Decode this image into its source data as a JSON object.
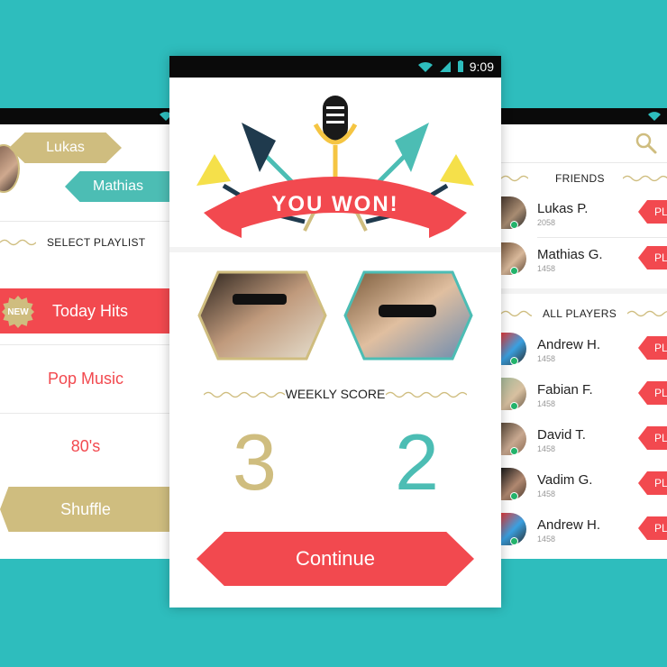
{
  "left_screen": {
    "players": [
      {
        "name": "Lukas"
      },
      {
        "name": "Mathias"
      }
    ],
    "section_title": "SELECT PLAYLIST",
    "playlists": [
      {
        "label": "Today Hits",
        "badge": "NEW"
      },
      {
        "label": "Pop Music"
      },
      {
        "label": "80's"
      }
    ],
    "shuffle_label": "Shuffle"
  },
  "center_screen": {
    "status": {
      "time": "9:09"
    },
    "banner_text": "YOU WON!",
    "weekly_score_label": "WEEKLY SCORE",
    "scores": {
      "player_one": "3",
      "player_two": "2"
    },
    "continue_label": "Continue",
    "colors": {
      "red": "#f2494f",
      "gold": "#cfbd7f",
      "teal": "#4cbdb4",
      "dark": "#1f3a4d"
    }
  },
  "right_screen": {
    "friends_title": "FRIENDS",
    "friends": [
      {
        "name": "Lukas P.",
        "score": "2058",
        "action": "PL"
      },
      {
        "name": "Mathias G.",
        "score": "1458",
        "action": "PL"
      }
    ],
    "all_players_title": "ALL PLAYERS",
    "all_players": [
      {
        "name": "Andrew H.",
        "score": "1458",
        "action": "PL"
      },
      {
        "name": "Fabian F.",
        "score": "1458",
        "action": "PL"
      },
      {
        "name": "David T.",
        "score": "1458",
        "action": "PL"
      },
      {
        "name": "Vadim G.",
        "score": "1458",
        "action": "PL"
      },
      {
        "name": "Andrew H.",
        "score": "1458",
        "action": "PL"
      }
    ],
    "icons": [
      "search-icon",
      "wifi-icon"
    ]
  }
}
